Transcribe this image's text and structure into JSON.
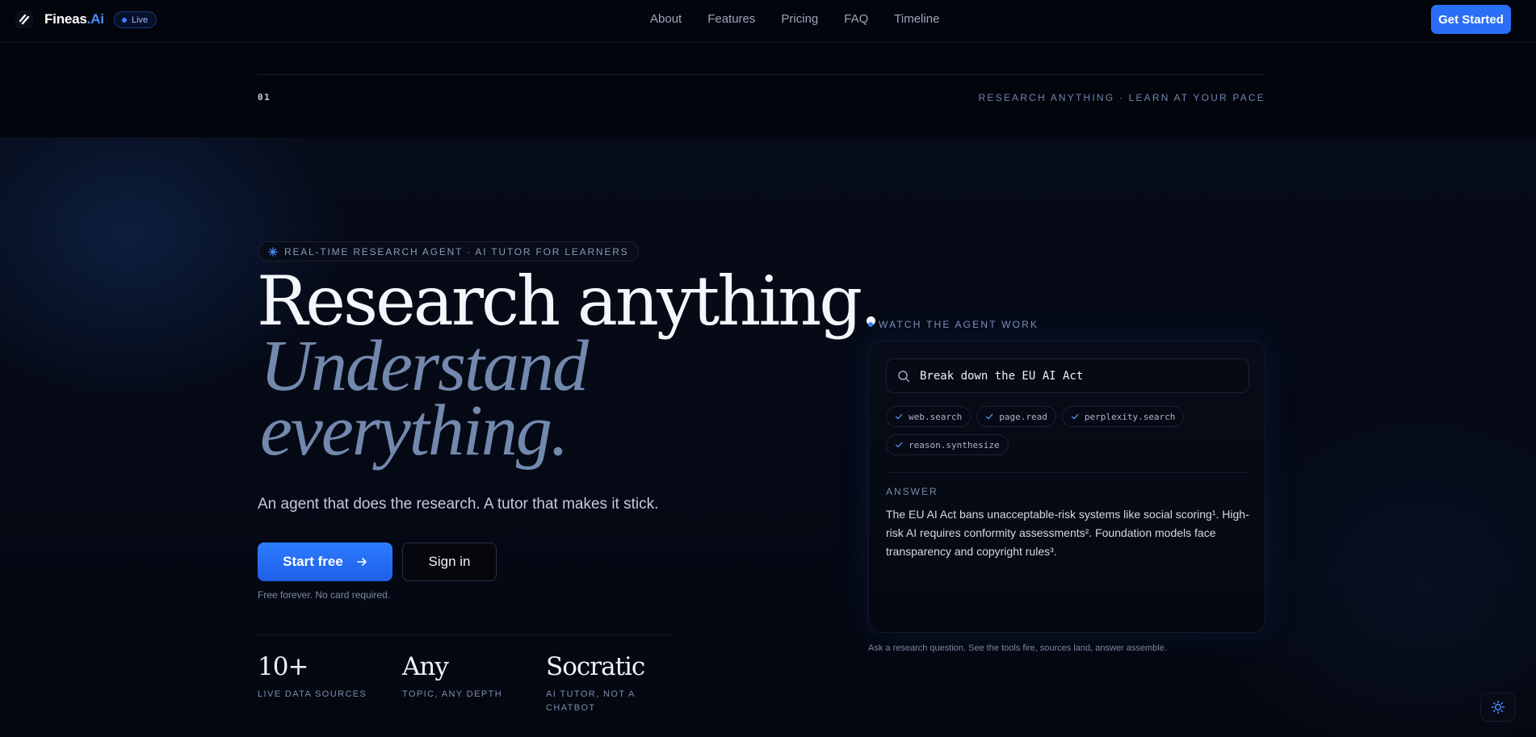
{
  "header": {
    "brand_name": "Fineas",
    "brand_suffix": ".Ai",
    "live_badge": "Live",
    "nav": [
      "About",
      "Features",
      "Pricing",
      "FAQ",
      "Timeline"
    ],
    "cta": "Get Started"
  },
  "section": {
    "number": "01",
    "tag": "RESEARCH ANYTHING · LEARN AT YOUR PACE"
  },
  "hero": {
    "eyebrow": "REAL-TIME RESEARCH AGENT · AI TUTOR FOR LEARNERS",
    "headline_1": "Research anything.",
    "headline_2a": "Understand",
    "headline_2b": "everything.",
    "subheadline": "An agent that does the research. A tutor that makes it stick.",
    "primary_button": "Start free",
    "secondary_button": "Sign in",
    "fine_print": "Free forever. No card required.",
    "stats": [
      {
        "value": "10+",
        "label": "LIVE DATA SOURCES"
      },
      {
        "value": "Any",
        "label": "TOPIC, ANY DEPTH"
      },
      {
        "value": "Socratic",
        "label_1": "AI TUTOR, NOT A",
        "label_2": "CHATBOT"
      }
    ]
  },
  "agent": {
    "title": "WATCH THE AGENT WORK",
    "query": "Break down the EU AI Act",
    "tools": [
      "web.search",
      "page.read",
      "perplexity.search",
      "reason.synthesize"
    ],
    "answer_label": "ANSWER",
    "answer_text": "The EU AI Act bans unacceptable-risk systems like social scoring¹. High-risk AI requires conformity assessments². Foundation models face transparency and copyright rules³.",
    "caption": "Ask a research question. See the tools fire, sources land, answer assemble."
  },
  "colors": {
    "accent": "#2a6ef5",
    "background": "#03050c",
    "headline_muted": "#7388ad"
  },
  "icons": {
    "logo": "brand-slash-logo",
    "eyebrow": "sparkle-icon",
    "arrow": "arrow-right-icon",
    "search": "search-icon",
    "check": "check-icon",
    "theme": "sun-icon"
  }
}
